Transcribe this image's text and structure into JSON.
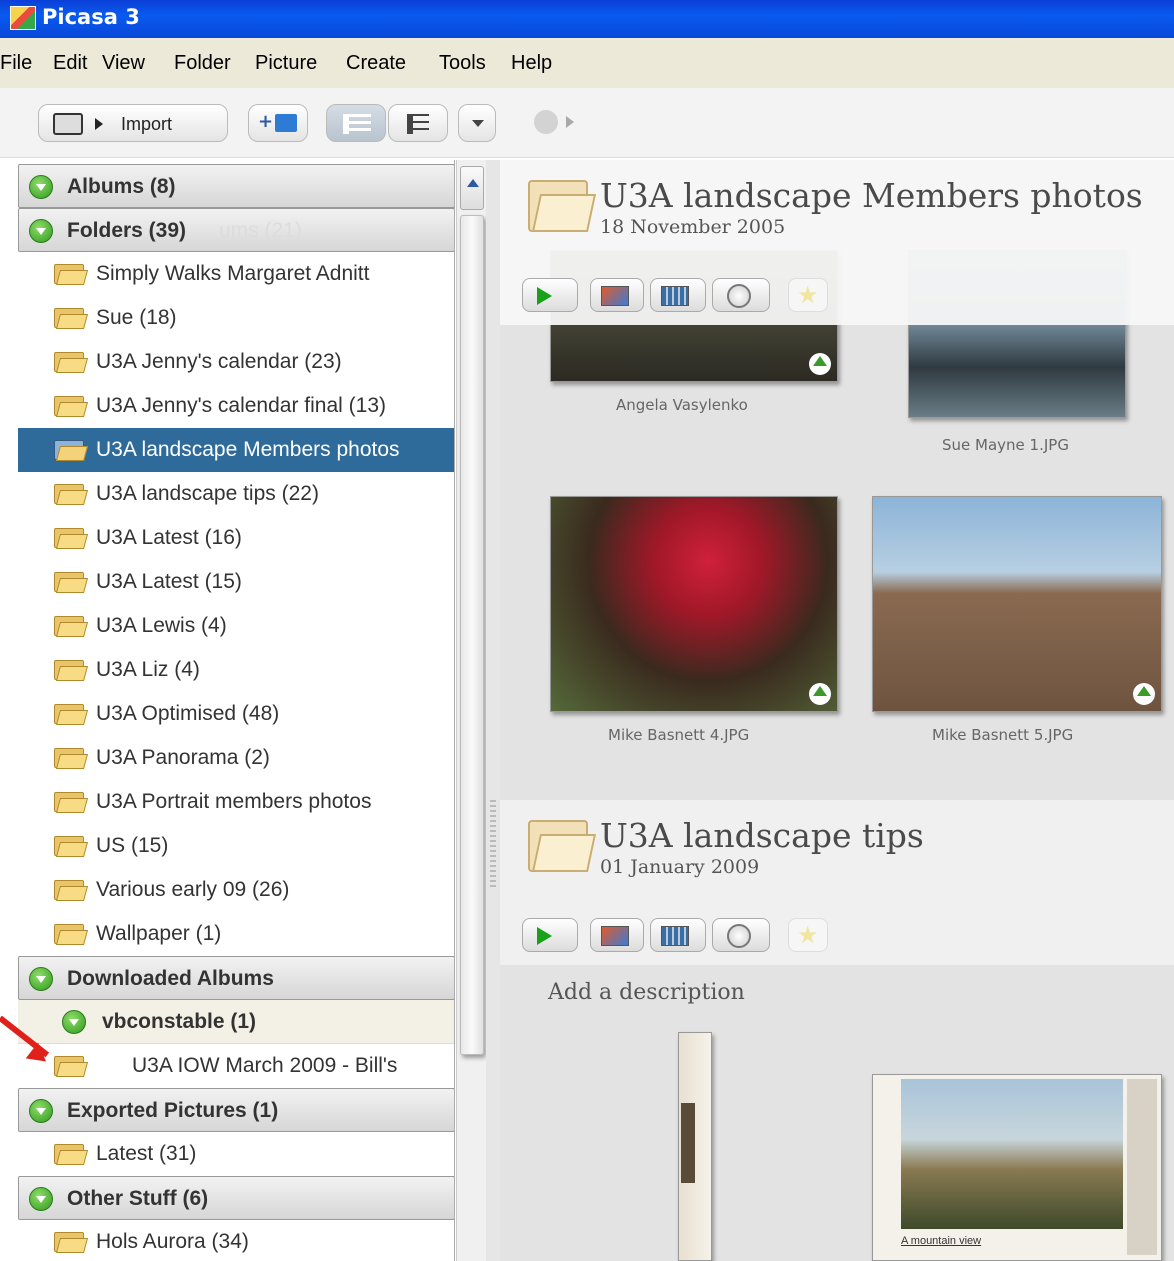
{
  "window": {
    "title": "Picasa 3"
  },
  "menu": [
    "File",
    "Edit",
    "View",
    "Folder",
    "Picture",
    "Create",
    "Tools",
    "Help"
  ],
  "toolbar": {
    "import_label": "Import"
  },
  "sidebar": {
    "albums_header": "Albums (8)",
    "folders_header": "Folders (39)",
    "folders_ghost": "ums (21)",
    "folders": [
      "Simply Walks Margaret Adnitt",
      "Sue (18)",
      "U3A Jenny's calendar (23)",
      "U3A Jenny's calendar final (13)",
      "U3A landscape Members photos",
      "U3A landscape tips (22)",
      "U3A Latest (16)",
      "U3A Latest (15)",
      "U3A Lewis (4)",
      "U3A Liz (4)",
      "U3A Optimised (48)",
      "U3A Panorama (2)",
      "U3A Portrait members photos",
      "US (15)",
      "Various early 09 (26)",
      "Wallpaper (1)"
    ],
    "selected_folder_index": 4,
    "downloaded_header": "Downloaded Albums",
    "downloaded_user": "vbconstable (1)",
    "downloaded_album": "U3A IOW March 2009 - Bill's",
    "exported_header": "Exported Pictures (1)",
    "exported_item": "Latest (31)",
    "other_header": "Other Stuff (6)",
    "other_item": "Hols Aurora (34)"
  },
  "main": {
    "section1": {
      "title": "U3A landscape Members photos",
      "date": "18 November 2005",
      "captions": [
        "Angela Vasylenko",
        "Sue Mayne 1.JPG",
        "Mike Basnett 4.JPG",
        "Mike Basnett 5.JPG"
      ]
    },
    "section2": {
      "title": "U3A landscape tips",
      "date": "01 January 2009",
      "description_placeholder": "Add a description",
      "thumb_caption": "A mountain view"
    }
  },
  "colors": {
    "selection": "#2f6b9a",
    "titlebar": "#0a50e4",
    "annotation_arrow": "#e0201a"
  }
}
